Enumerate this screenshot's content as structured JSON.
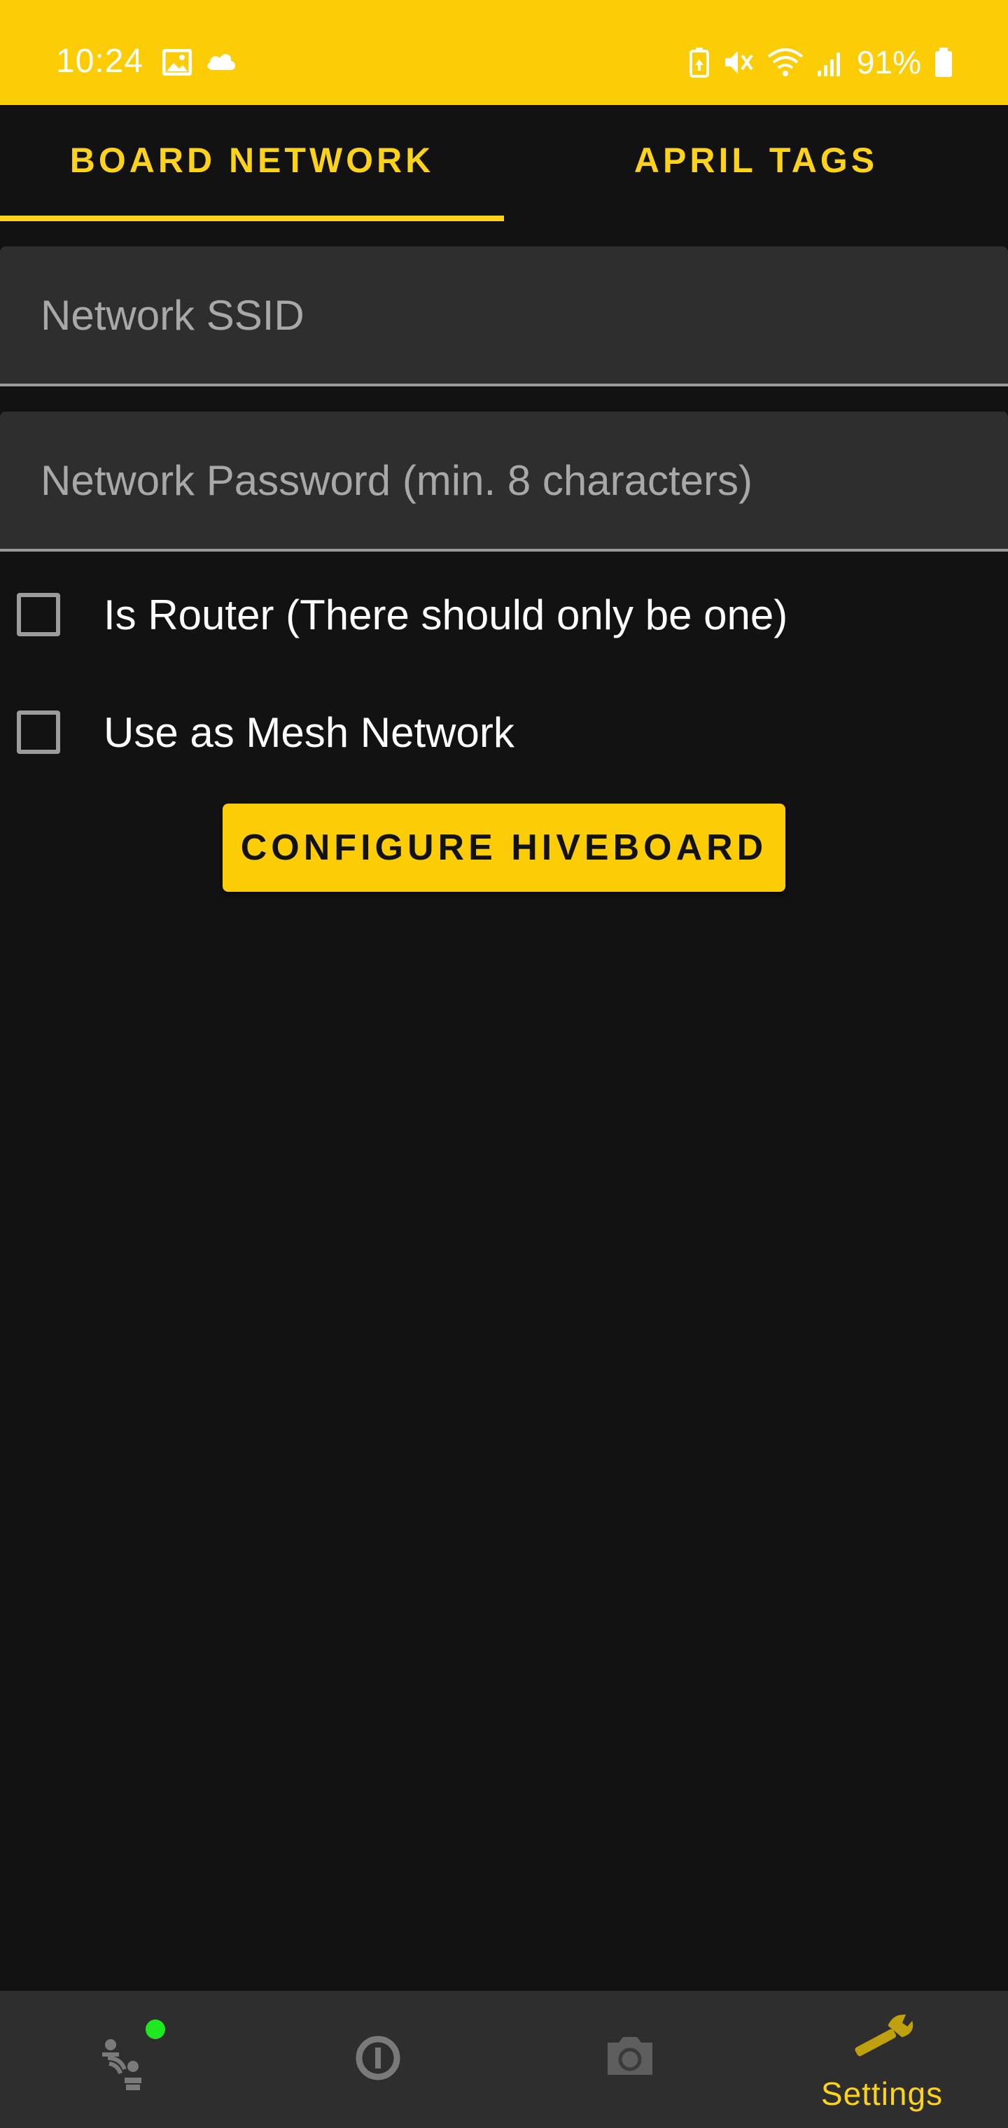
{
  "status_bar": {
    "time": "10:24",
    "battery_text": "91%",
    "left_icons": [
      "image-icon",
      "cloud-icon"
    ],
    "right_icons": [
      "battery-saver-icon",
      "mute-icon",
      "wifi-icon",
      "signal-icon",
      "battery-icon"
    ],
    "background_color": "#FCCC05"
  },
  "tabs": [
    {
      "label": "BOARD NETWORK",
      "selected": true
    },
    {
      "label": "APRIL TAGS",
      "selected": false
    }
  ],
  "form": {
    "ssid_placeholder": "Network SSID",
    "ssid_value": "",
    "password_placeholder": "Network Password (min. 8 characters)",
    "password_value": "",
    "checkboxes": [
      {
        "label": "Is Router (There should only be one)",
        "checked": false
      },
      {
        "label": "Use as Mesh Network",
        "checked": false
      }
    ],
    "configure_button": "CONFIGURE HIVEBOARD"
  },
  "bottom_nav": {
    "items": [
      {
        "icon": "connection-icon",
        "label": "",
        "status_dot_color": "#1EE81E"
      },
      {
        "icon": "info-circle-icon",
        "label": ""
      },
      {
        "icon": "camera-icon",
        "label": ""
      },
      {
        "icon": "wrench-icon",
        "label": "Settings",
        "selected": true
      }
    ]
  },
  "colors": {
    "accent": "#FCD21B",
    "background": "#121212",
    "surface": "#2E2E2E",
    "inactive_icon": "#7A7A7A"
  }
}
